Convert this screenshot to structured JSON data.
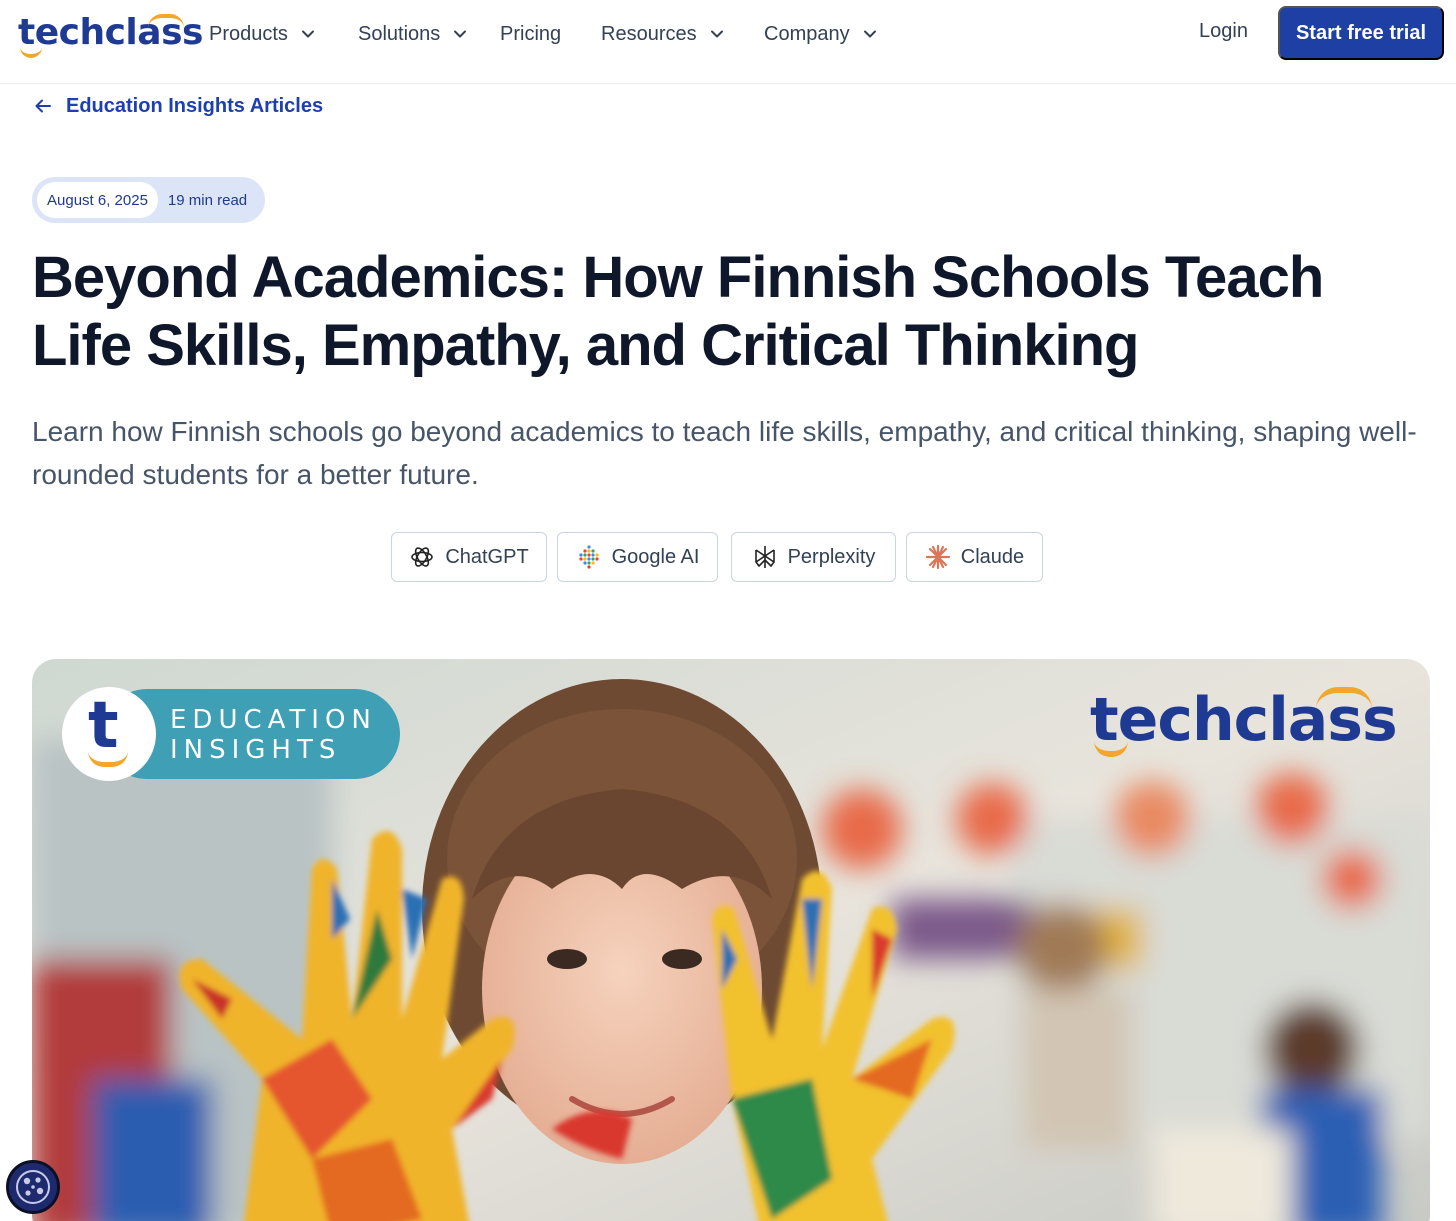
{
  "header": {
    "logo_text": "techclass",
    "nav": [
      {
        "label": "Products",
        "has_dropdown": true
      },
      {
        "label": "Solutions",
        "has_dropdown": true
      },
      {
        "label": "Pricing",
        "has_dropdown": false
      },
      {
        "label": "Resources",
        "has_dropdown": true
      },
      {
        "label": "Company",
        "has_dropdown": true
      }
    ],
    "login_label": "Login",
    "cta_label": "Start free trial"
  },
  "breadcrumb": {
    "back_label": "Education Insights Articles",
    "icon": "arrow-left-icon"
  },
  "article": {
    "date": "August 6, 2025",
    "read_time": "19 min read",
    "title": "Beyond Academics: How Finnish Schools Teach Life Skills, Empathy, and Critical Thinking",
    "description": "Learn how Finnish schools go beyond academics to teach life skills, empathy, and critical thinking, shaping well-rounded students for a better future."
  },
  "ai_buttons": [
    {
      "label": "ChatGPT",
      "icon": "chatgpt-icon"
    },
    {
      "label": "Google AI",
      "icon": "google-ai-icon"
    },
    {
      "label": "Perplexity",
      "icon": "perplexity-icon"
    },
    {
      "label": "Claude",
      "icon": "claude-icon"
    }
  ],
  "hero": {
    "badge_letter": "t",
    "badge_line1": "EDUCATION",
    "badge_line2": "INSIGHTS",
    "logo_text": "techclass"
  },
  "colors": {
    "brand_blue": "#1e3fa3",
    "brand_orange": "#f4a62a",
    "badge_teal": "#3f9fb5"
  }
}
